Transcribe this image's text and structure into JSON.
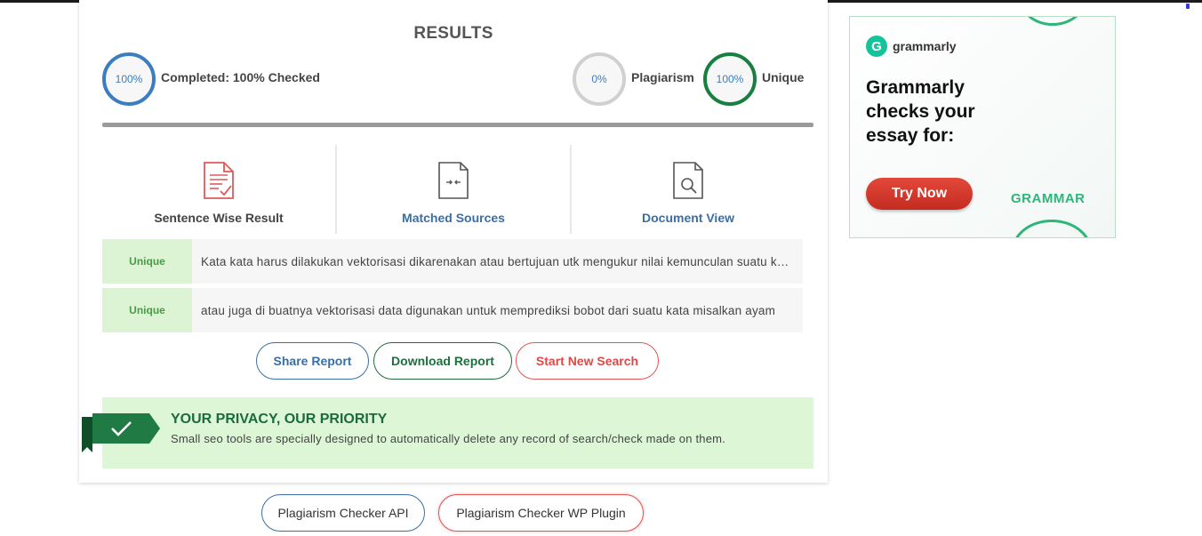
{
  "results": {
    "title": "RESULTS",
    "completed": {
      "percent": "100%",
      "label": "Completed: 100% Checked"
    },
    "plagiarism": {
      "percent": "0%",
      "label": "Plagiarism"
    },
    "unique": {
      "percent": "100%",
      "label": "Unique"
    }
  },
  "views": [
    {
      "label": "Sentence Wise Result",
      "icon": "document-check-icon"
    },
    {
      "label": "Matched Sources",
      "icon": "document-compare-icon"
    },
    {
      "label": "Document View",
      "icon": "document-search-icon"
    }
  ],
  "rows": [
    {
      "status": "Unique",
      "text": "Kata kata harus dilakukan vektorisasi dikarenakan atau bertujuan utk mengukur nilai kemunculan suatu kata"
    },
    {
      "status": "Unique",
      "text": "atau juga di buatnya vektorisasi data digunakan untuk memprediksi bobot dari suatu kata misalkan ayam"
    }
  ],
  "actions": {
    "share": "Share Report",
    "download": "Download Report",
    "new_search": "Start New Search"
  },
  "privacy": {
    "title": "YOUR PRIVACY, OUR PRIORITY",
    "text": "Small seo tools are specially designed to automatically delete any record of search/check made on them."
  },
  "ad": {
    "brand": "grammarly",
    "headline": "Grammarly checks your essay for:",
    "cta": "Try Now",
    "tag": "GRAMMAR"
  },
  "bottom": {
    "api": "Plagiarism Checker API",
    "wp": "Plagiarism Checker WP Plugin"
  },
  "colors": {
    "blue": "#3a7dc0",
    "green": "#177f3f",
    "red": "#e04848",
    "unique_bg": "#dcf4d3"
  }
}
